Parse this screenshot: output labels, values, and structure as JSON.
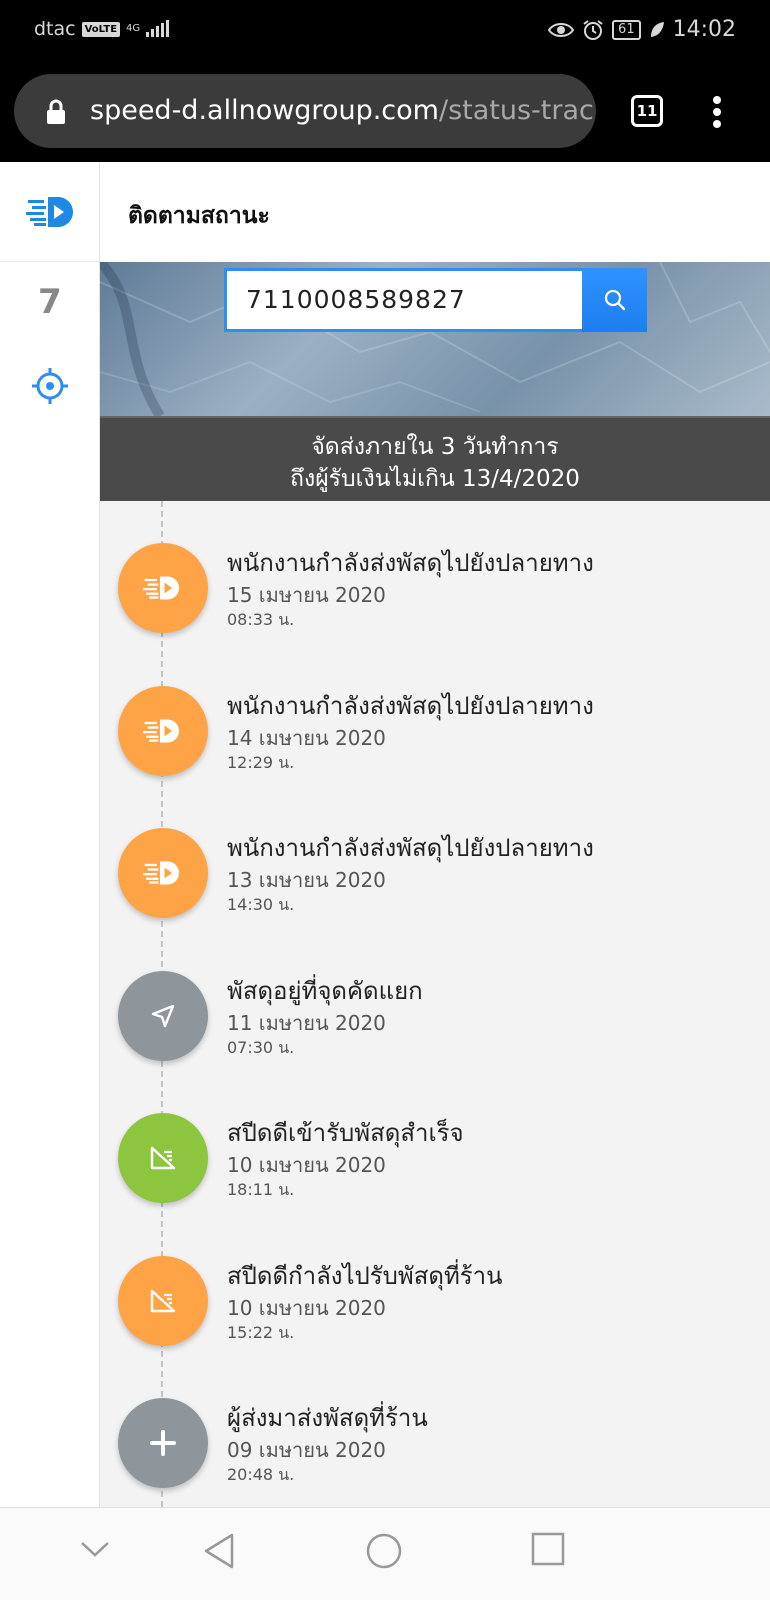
{
  "status_bar": {
    "carrier": "dtac",
    "volte_badge": "VoLTE",
    "network": "4G",
    "battery": "61",
    "time": "14:02"
  },
  "browser": {
    "url_domain": "speed-d.allnowgroup.com",
    "url_path": "/status-trac",
    "tab_count": "11"
  },
  "sidebar": {
    "item_7": "7"
  },
  "header": {
    "title": "ติดตามสถานะ"
  },
  "search": {
    "value": "7110008589827"
  },
  "notice": {
    "line1": "จัดส่งภายใน 3 วันทำการ",
    "line2": "ถึงผู้รับเงินไม่เกิน 13/4/2020"
  },
  "timeline": [
    {
      "title": "พนักงานกำลังส่งพัสดุไปยังปลายทาง",
      "date": "15 เมษายน 2020",
      "time": "08:33 น.",
      "icon": "speed-d-logo-icon",
      "color": "#ffa347"
    },
    {
      "title": "พนักงานกำลังส่งพัสดุไปยังปลายทาง",
      "date": "14 เมษายน 2020",
      "time": "12:29 น.",
      "icon": "speed-d-logo-icon",
      "color": "#ffa347"
    },
    {
      "title": "พนักงานกำลังส่งพัสดุไปยังปลายทาง",
      "date": "13 เมษายน 2020",
      "time": "14:30 น.",
      "icon": "speed-d-logo-icon",
      "color": "#ffa347"
    },
    {
      "title": "พัสดุอยู่ที่จุดคัดแยก",
      "date": "11 เมษายน 2020",
      "time": "07:30 น.",
      "icon": "navigation-arrow-icon",
      "color": "#8e969b"
    },
    {
      "title": "สปีดดีเข้ารับพัสดุสำเร็จ",
      "date": "10 เมษายน 2020",
      "time": "18:11 น.",
      "icon": "parcel-pickup-icon",
      "color": "#8cc63f"
    },
    {
      "title": "สปีดดีกำลังไปรับพัสดุที่ร้าน",
      "date": "10 เมษายน 2020",
      "time": "15:22 น.",
      "icon": "parcel-pickup-icon",
      "color": "#ffa347"
    },
    {
      "title": "ผู้ส่งมาส่งพัสดุที่ร้าน",
      "date": "09 เมษายน 2020",
      "time": "20:48 น.",
      "icon": "plus-icon",
      "color": "#8e969b"
    }
  ]
}
